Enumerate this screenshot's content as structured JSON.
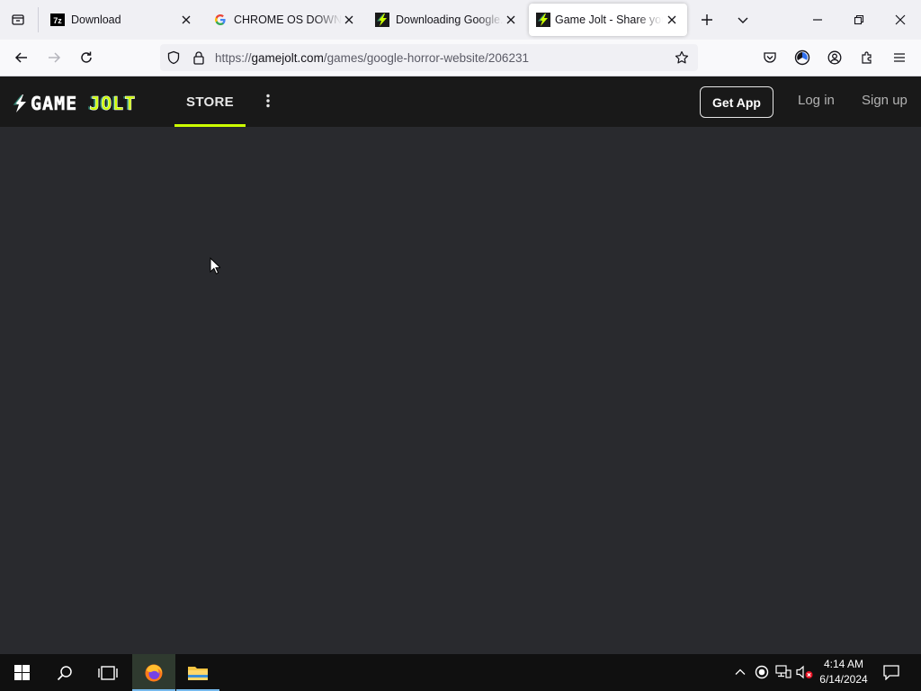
{
  "tabs": [
    {
      "title": "Download",
      "favicon": "7z-icon"
    },
    {
      "title": "CHROME OS DOWNLOAD",
      "favicon": "google-icon"
    },
    {
      "title": "Downloading Google.exe",
      "favicon": "gamejolt-icon"
    },
    {
      "title": "Game Jolt - Share your",
      "favicon": "gamejolt-icon"
    }
  ],
  "address_bar": {
    "url_prefix": "https://",
    "url_host": "gamejolt.com",
    "url_path": "/games/google-horror-website/206231"
  },
  "site": {
    "logo_game": "GAME",
    "logo_jolt": "JOLT",
    "nav_store": "STORE",
    "get_app": "Get App",
    "log_in": "Log in",
    "sign_up": "Sign up",
    "accent_color": "#ccff00"
  },
  "taskbar": {
    "time": "4:14 AM",
    "date": "6/14/2024"
  }
}
